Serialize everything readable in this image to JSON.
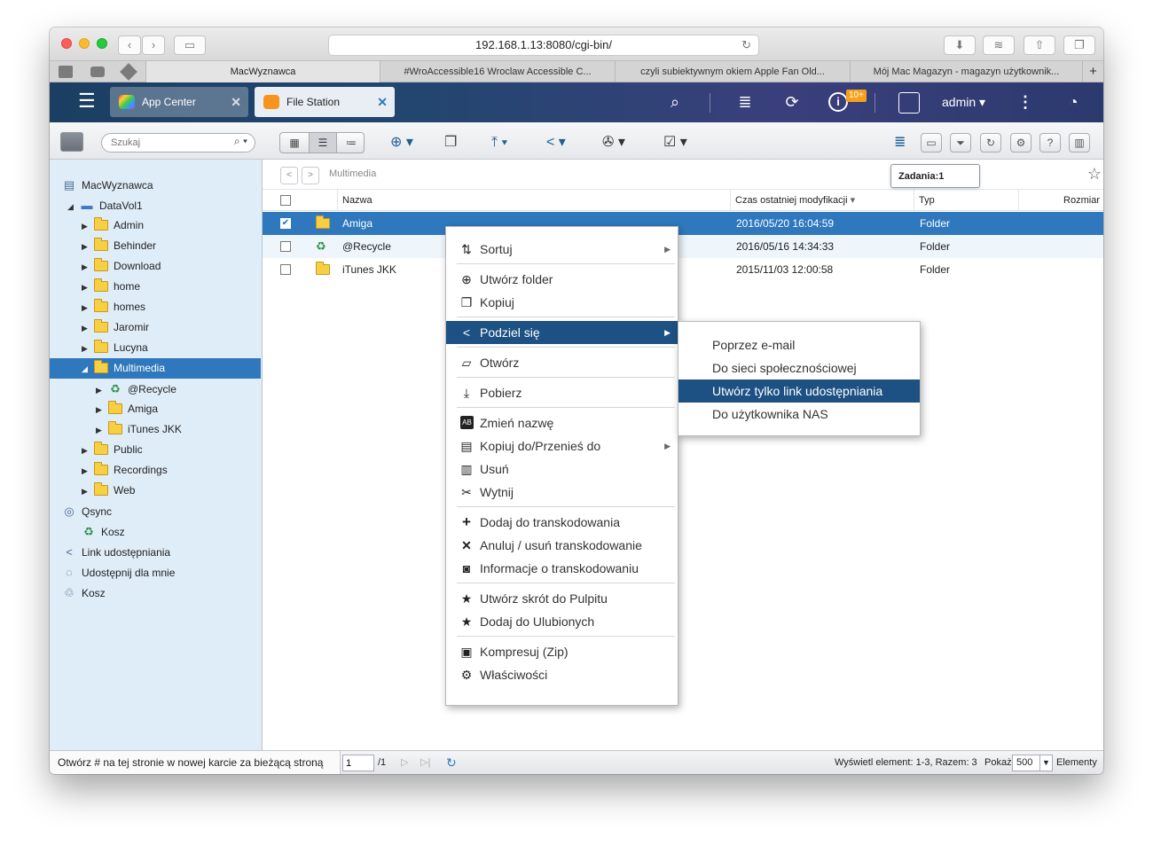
{
  "browser": {
    "url": "192.168.1.13:8080/cgi-bin/",
    "tabs": [
      "MacWyznawca",
      "#WroAccessible16 Wroclaw Accessible C...",
      "czyli subiektywnym okiem Apple Fan Old...",
      "Mój Mac Magazyn - magazyn użytkownik..."
    ],
    "new_tab": "+"
  },
  "qnap": {
    "tabs": [
      {
        "label": "App Center"
      },
      {
        "label": "File Station"
      }
    ],
    "user": "admin",
    "notify_badge": "10+"
  },
  "toolbar": {
    "search_placeholder": "Szukaj"
  },
  "tree": {
    "root": "MacWyznawca",
    "volume": "DataVol1",
    "folders": [
      "Admin",
      "Behinder",
      "Download",
      "home",
      "homes",
      "Jaromir",
      "Lucyna",
      "Multimedia"
    ],
    "multimedia_children": [
      "@Recycle",
      "Amiga",
      "iTunes JKK"
    ],
    "folders_after": [
      "Public",
      "Recordings",
      "Web"
    ],
    "qsync": "Qsync",
    "kosz_sub": "Kosz",
    "share_link": "Link udostępniania",
    "shared_with_me": "Udostępnij dla mnie",
    "trash": "Kosz"
  },
  "main": {
    "breadcrumb": "Multimedia",
    "columns": {
      "name": "Nazwa",
      "modified": "Czas ostatniej modyfikacji",
      "type": "Typ",
      "size": "Rozmiar"
    },
    "rows": [
      {
        "name": "Amiga",
        "modified": "2016/05/20 16:04:59",
        "type": "Folder"
      },
      {
        "name": "@Recycle",
        "modified": "2016/05/16 14:34:33",
        "type": "Folder"
      },
      {
        "name": "iTunes JKK",
        "modified": "2015/11/03 12:00:58",
        "type": "Folder"
      }
    ],
    "tasks_tooltip": "Zadania:1"
  },
  "context_menu": {
    "items": [
      "Sortuj",
      "Utwórz folder",
      "Kopiuj",
      "Podziel się",
      "Otwórz",
      "Pobierz",
      "Zmień nazwę",
      "Kopiuj do/Przenieś do",
      "Usuń",
      "Wytnij",
      "Dodaj do transkodowania",
      "Anuluj / usuń transkodowanie",
      "Informacje o transkodowaniu",
      "Utwórz skrót do Pulpitu",
      "Dodaj do Ulubionych",
      "Kompresuj (Zip)",
      "Właściwości"
    ],
    "share_submenu": [
      "Poprzez e-mail",
      "Do sieci społecznościowej",
      "Utwórz tylko link udostępniania",
      "Do użytkownika NAS"
    ]
  },
  "status": {
    "hint": "Otwórz # na tej stronie w nowej karcie za bieżącą stroną",
    "page": "1",
    "page_total": "/1",
    "display_info": "Wyświetl element: 1-3, Razem: 3",
    "show_label": "Pokaż",
    "per_page": "500",
    "elements_label": "Elementy"
  }
}
